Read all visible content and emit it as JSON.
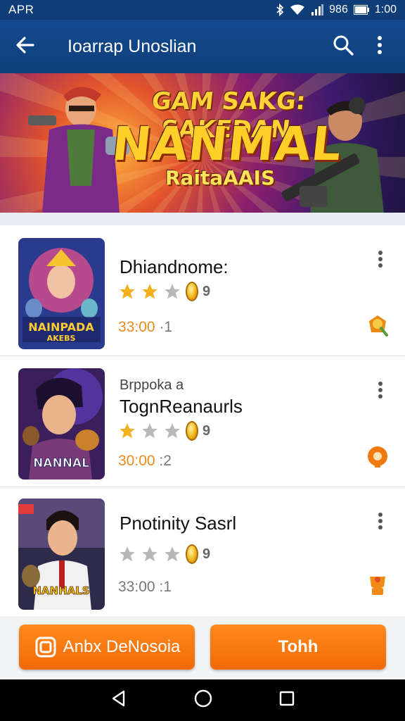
{
  "status_bar": {
    "carrier": "APR",
    "network": "986",
    "time": "1:00"
  },
  "app_bar": {
    "title": "Ioarrap Unoslian",
    "back_icon": "arrow-left-icon",
    "search_icon": "search-icon",
    "menu_icon": "more-vert-icon"
  },
  "banner": {
    "line1": "GAM SAKG: SAKEDAN",
    "line2": "NANMAL",
    "line3": "RaitaAAIS"
  },
  "items": [
    {
      "title": "Dhiandnome:",
      "subtitle": "",
      "stars_filled": 2,
      "stars_total": 3,
      "rating_num": "9",
      "price": "33:00",
      "price_tail": "·1",
      "thumb_text": "NAINPADA\nAKEBS",
      "badge_color": "#e88a14"
    },
    {
      "title": "TognReanaurls",
      "subtitle": "Brppoka a",
      "stars_filled": 1,
      "stars_total": 3,
      "rating_num": "9",
      "price": "30:00",
      "price_tail": ":2",
      "thumb_text": "NANNAL",
      "badge_color": "#f07a12"
    },
    {
      "title": "Pnotinity Sasrl",
      "subtitle": "",
      "stars_filled": 0,
      "stars_total": 3,
      "rating_num": "9",
      "price": "33:00",
      "price_tail": ":1",
      "thumb_text": "NANHALS",
      "badge_color": "#f28a16"
    }
  ],
  "buttons": {
    "left_label": "Anbx DeNosoia",
    "right_label": "Tohh"
  },
  "colors": {
    "app_bar": "#134a8e",
    "accent": "#f26a05",
    "star": "#f2b01e",
    "star_empty": "#b8b8b8"
  }
}
